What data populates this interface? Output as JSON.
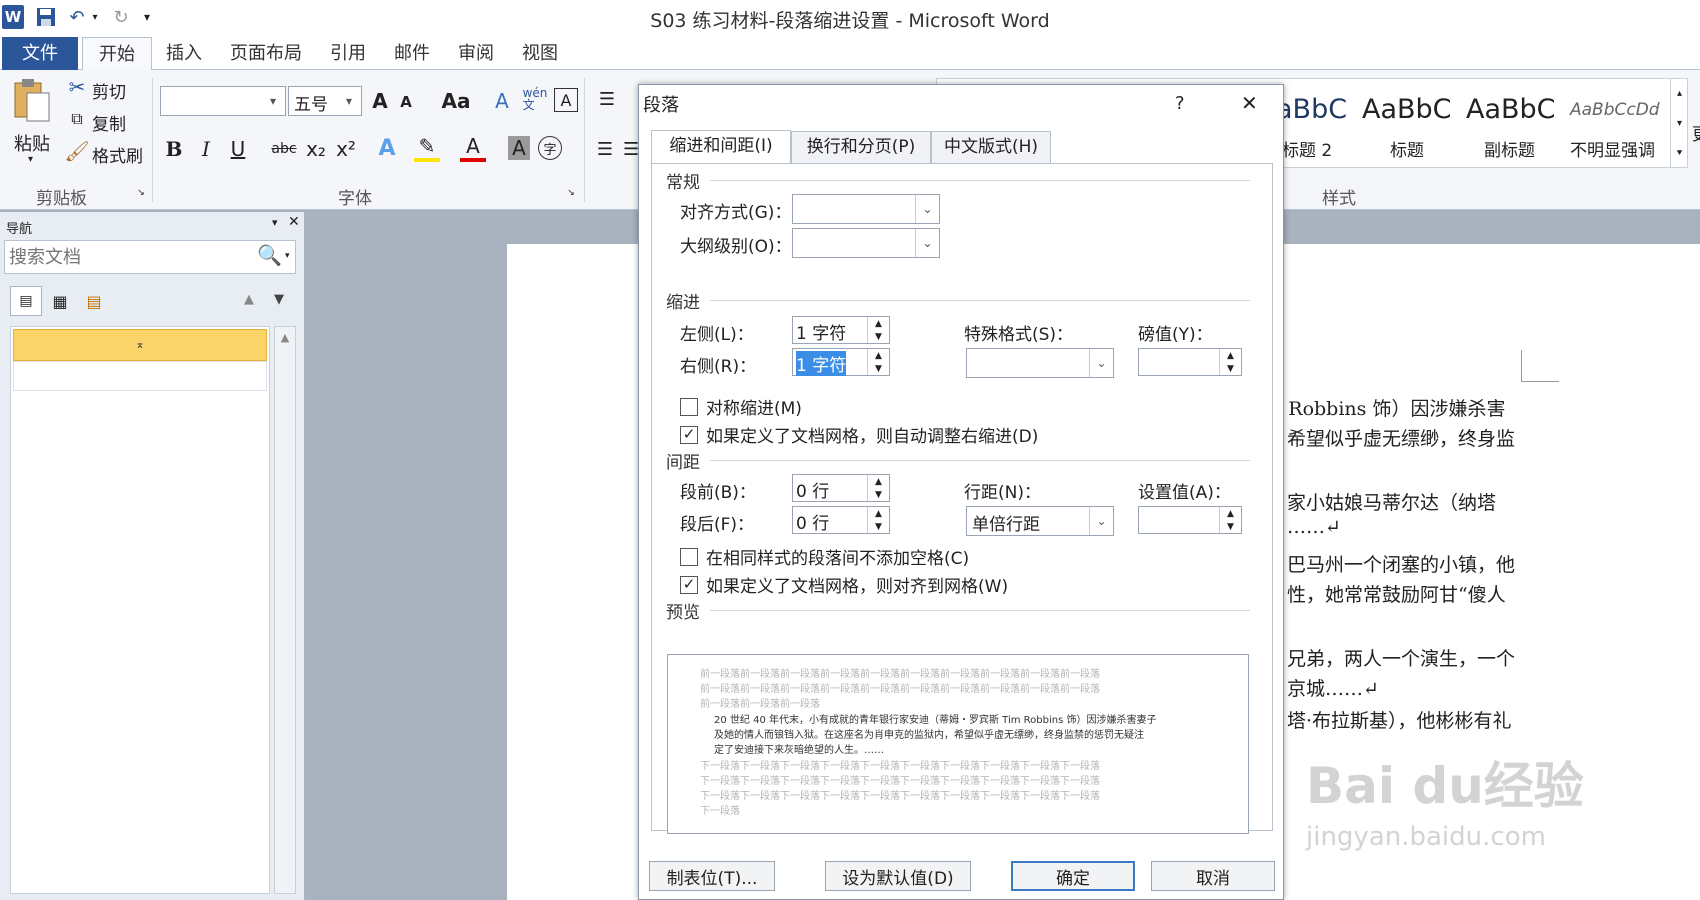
{
  "window": {
    "title": "S03 练习材料-段落缩进设置 - Microsoft Word"
  },
  "qat": {
    "word_icon": "W",
    "save_icon": "save-icon",
    "undo_icon": "undo-icon",
    "redo_icon": "redo-icon",
    "customize_icon": "▾"
  },
  "ribbon_tabs": [
    "文件",
    "开始",
    "插入",
    "页面布局",
    "引用",
    "邮件",
    "审阅",
    "视图"
  ],
  "clipboard": {
    "paste": "粘贴",
    "cut": "剪切",
    "copy": "复制",
    "format_painter": "格式刷",
    "group": "剪贴板"
  },
  "font": {
    "name": "",
    "size": "五号",
    "group": "字体",
    "bold": "B",
    "italic": "I",
    "underline": "U",
    "strike": "abc",
    "sub": "x₂",
    "sup": "x²",
    "grow": "A",
    "shrink": "A",
    "case": "Aa",
    "font_color": "A",
    "char_shade": "A",
    "enclose": "字",
    "wen": "wén\n文",
    "clear": "A"
  },
  "styles": {
    "group": "样式",
    "items": [
      {
        "preview": "aBbC",
        "name": "标题 2"
      },
      {
        "preview": "AaBbC",
        "name": "标题"
      },
      {
        "preview": "AaBbC",
        "name": "副标题"
      },
      {
        "preview": "AaBbCcDd",
        "name": "不明显强调"
      }
    ],
    "more_label": "更"
  },
  "nav": {
    "title": "导航",
    "search_placeholder": "搜索文档"
  },
  "dialog": {
    "title": "段落",
    "help": "?",
    "close": "✕",
    "tabs": [
      "缩进和间距(I)",
      "换行和分页(P)",
      "中文版式(H)"
    ],
    "general": {
      "section": "常规",
      "alignment_label": "对齐方式(G)：",
      "alignment_value": "",
      "outline_label": "大纲级别(O)：",
      "outline_value": ""
    },
    "indent": {
      "section": "缩进",
      "left_label": "左侧(L)：",
      "left_value": "1 字符",
      "right_label": "右侧(R)：",
      "right_value": "1 字符",
      "special_label": "特殊格式(S)：",
      "special_value": "",
      "by_label": "磅值(Y)：",
      "by_value": "",
      "mirror": "对称缩进(M)",
      "auto_adjust": "如果定义了文档网格，则自动调整右缩进(D)"
    },
    "spacing": {
      "section": "间距",
      "before_label": "段前(B)：",
      "before_value": "0 行",
      "after_label": "段后(F)：",
      "after_value": "0 行",
      "line_label": "行距(N)：",
      "line_value": "单倍行距",
      "at_label": "设置值(A)：",
      "at_value": "",
      "no_space": "在相同样式的段落间不添加空格(C)",
      "snap_grid": "如果定义了文档网格，则对齐到网格(W)"
    },
    "preview": {
      "section": "预览",
      "prev_lines": [
        "前一段落前一段落前一段落前一段落前一段落前一段落前一段落前一段落前一段落前一段落",
        "前一段落前一段落前一段落前一段落前一段落前一段落前一段落前一段落前一段落前一段落",
        "前一段落前一段落前一段落"
      ],
      "main_lines": [
        "20 世纪 40 年代末，小有成就的青年银行家安迪（蒂姆・罗宾斯 Tim Robbins 饰）因涉嫌杀害妻子",
        "及她的情人而锒铛入狱。在这座名为肖申克的监狱内，希望似乎虚无缥缈，终身监禁的惩罚无疑注",
        "定了安迪接下来灰暗绝望的人生。……"
      ],
      "next_lines": [
        "下一段落下一段落下一段落下一段落下一段落下一段落下一段落下一段落下一段落下一段落",
        "下一段落下一段落下一段落下一段落下一段落下一段落下一段落下一段落下一段落下一段落",
        "下一段落下一段落下一段落下一段落下一段落下一段落下一段落下一段落下一段落下一段落",
        "下一段落"
      ]
    },
    "buttons": {
      "tabs": "制表位(T)...",
      "default": "设为默认值(D)",
      "ok": "确定",
      "cancel": "取消"
    }
  },
  "document": {
    "lines": [
      "n Robbins  饰）因涉嫌杀害",
      "希望似乎虚无缥缈，终身监",
      "家小姑娘马蒂尔达（纳塔",
      "……↵",
      "巴马州一个闭塞的小镇，他",
      "性，她常常鼓励阿甘“傻人",
      "兄弟，两人一个演生，一个",
      "京城……↵",
      "塔·布拉斯基），他彬彬有礼"
    ]
  },
  "watermark": {
    "brand": "Bai du经验",
    "url": "jingyan.baidu.com"
  }
}
